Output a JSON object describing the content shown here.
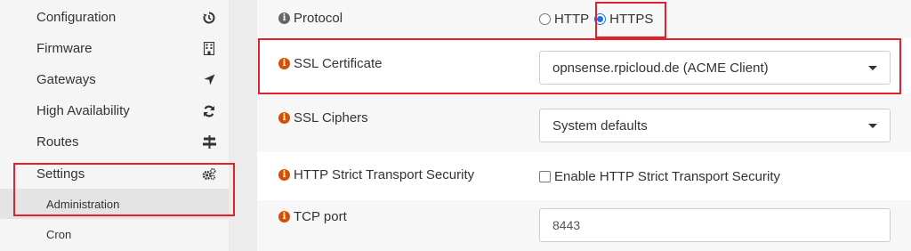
{
  "sidebar": {
    "items": [
      {
        "label": "Configuration",
        "icon": "history-icon"
      },
      {
        "label": "Firmware",
        "icon": "building-icon"
      },
      {
        "label": "Gateways",
        "icon": "location-arrow-icon"
      },
      {
        "label": "High Availability",
        "icon": "refresh-icon"
      },
      {
        "label": "Routes",
        "icon": "signpost-icon"
      },
      {
        "label": "Settings",
        "icon": "cogs-icon"
      }
    ],
    "subitems": [
      {
        "label": "Administration",
        "active": true
      },
      {
        "label": "Cron",
        "active": false
      }
    ]
  },
  "form": {
    "protocol": {
      "label": "Protocol",
      "options": [
        "HTTP",
        "HTTPS"
      ],
      "selected": "HTTPS"
    },
    "ssl_certificate": {
      "label": "SSL Certificate",
      "value": "opnsense.rpicloud.de (ACME Client)"
    },
    "ssl_ciphers": {
      "label": "SSL Ciphers",
      "value": "System defaults"
    },
    "hsts": {
      "label": "HTTP Strict Transport Security",
      "checkbox_label": "Enable HTTP Strict Transport Security",
      "checked": false
    },
    "tcp_port": {
      "label": "TCP port",
      "value": "8443"
    }
  },
  "colors": {
    "highlight": "#e3202b",
    "info_icon": "#d94f00",
    "radio_selected": "#1a73e8"
  }
}
